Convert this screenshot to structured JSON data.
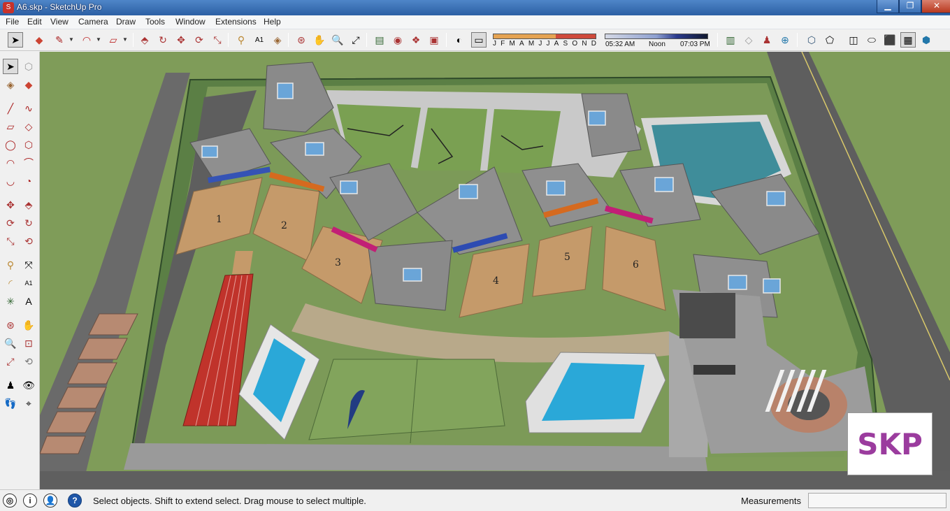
{
  "window": {
    "title": "A6.skp - SketchUp Pro",
    "controls": [
      "minimize",
      "restore",
      "close"
    ]
  },
  "menu": [
    "File",
    "Edit",
    "View",
    "Camera",
    "Draw",
    "Tools",
    "Window",
    "Extensions",
    "Help"
  ],
  "shadow_settings": {
    "months": [
      "J",
      "F",
      "M",
      "A",
      "M",
      "J",
      "J",
      "A",
      "S",
      "O",
      "N",
      "D"
    ],
    "time_start": "05:32 AM",
    "time_mid": "Noon",
    "time_end": "07:03 PM"
  },
  "model": {
    "plot_labels": [
      "1",
      "2",
      "3",
      "4",
      "5",
      "6"
    ]
  },
  "watermark": "SKP",
  "status": {
    "message": "Select objects. Shift to extend select. Drag mouse to select multiple.",
    "measurements_label": "Measurements",
    "measurements_value": ""
  },
  "colors": {
    "titlebar": "#2b5fa4",
    "grass": "#6f9b4c",
    "plot": "#c59a6a",
    "roof": "#8a8a8a",
    "pool": "#1aa8d8",
    "track": "#c0332b",
    "watermark": "#9b3c9e"
  }
}
